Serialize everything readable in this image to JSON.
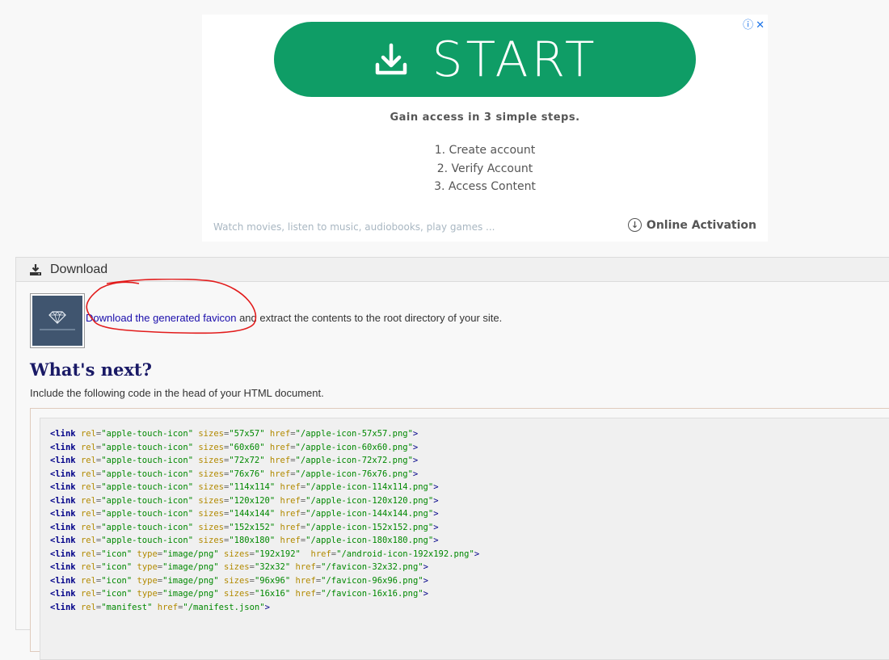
{
  "ad": {
    "adchoices_icon": "info-icon",
    "close_icon": "close-icon",
    "start_label": "START",
    "tagline": "Gain access in 3 simple steps.",
    "steps": [
      "1. Create account",
      "2. Verify Account",
      "3. Access Content"
    ],
    "footer_left": "Watch movies, listen to music, audiobooks, play games ...",
    "footer_right": "Online Activation",
    "accent": "#0f9d66"
  },
  "panel": {
    "title": "Download",
    "download_link": "Download the generated favicon",
    "download_rest": " and extract the contents to the root directory of your site.",
    "heading": "What's next?",
    "include_text": "Include the following code in the head of your HTML document."
  },
  "code": [
    [
      [
        "rel",
        "apple-touch-icon"
      ],
      [
        "sizes",
        "57x57"
      ],
      [
        "href",
        "/apple-icon-57x57.png"
      ]
    ],
    [
      [
        "rel",
        "apple-touch-icon"
      ],
      [
        "sizes",
        "60x60"
      ],
      [
        "href",
        "/apple-icon-60x60.png"
      ]
    ],
    [
      [
        "rel",
        "apple-touch-icon"
      ],
      [
        "sizes",
        "72x72"
      ],
      [
        "href",
        "/apple-icon-72x72.png"
      ]
    ],
    [
      [
        "rel",
        "apple-touch-icon"
      ],
      [
        "sizes",
        "76x76"
      ],
      [
        "href",
        "/apple-icon-76x76.png"
      ]
    ],
    [
      [
        "rel",
        "apple-touch-icon"
      ],
      [
        "sizes",
        "114x114"
      ],
      [
        "href",
        "/apple-icon-114x114.png"
      ]
    ],
    [
      [
        "rel",
        "apple-touch-icon"
      ],
      [
        "sizes",
        "120x120"
      ],
      [
        "href",
        "/apple-icon-120x120.png"
      ]
    ],
    [
      [
        "rel",
        "apple-touch-icon"
      ],
      [
        "sizes",
        "144x144"
      ],
      [
        "href",
        "/apple-icon-144x144.png"
      ]
    ],
    [
      [
        "rel",
        "apple-touch-icon"
      ],
      [
        "sizes",
        "152x152"
      ],
      [
        "href",
        "/apple-icon-152x152.png"
      ]
    ],
    [
      [
        "rel",
        "apple-touch-icon"
      ],
      [
        "sizes",
        "180x180"
      ],
      [
        "href",
        "/apple-icon-180x180.png"
      ]
    ],
    [
      [
        "rel",
        "icon"
      ],
      [
        "type",
        "image/png"
      ],
      [
        "sizes",
        "192x192"
      ],
      [
        "href",
        "/android-icon-192x192.png"
      ]
    ],
    [
      [
        "rel",
        "icon"
      ],
      [
        "type",
        "image/png"
      ],
      [
        "sizes",
        "32x32"
      ],
      [
        "href",
        "/favicon-32x32.png"
      ]
    ],
    [
      [
        "rel",
        "icon"
      ],
      [
        "type",
        "image/png"
      ],
      [
        "sizes",
        "96x96"
      ],
      [
        "href",
        "/favicon-96x96.png"
      ]
    ],
    [
      [
        "rel",
        "icon"
      ],
      [
        "type",
        "image/png"
      ],
      [
        "sizes",
        "16x16"
      ],
      [
        "href",
        "/favicon-16x16.png"
      ]
    ],
    [
      [
        "rel",
        "manifest"
      ],
      [
        "href",
        "/manifest.json"
      ]
    ]
  ]
}
